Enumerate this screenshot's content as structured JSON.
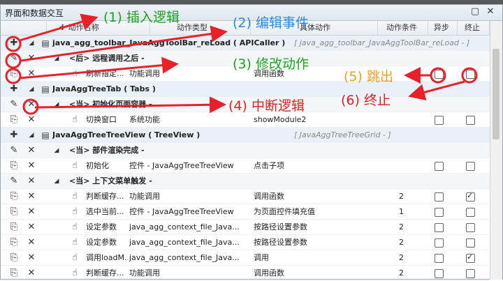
{
  "window": {
    "title": "界面和数据交互",
    "minimize_icon": "minimize-icon",
    "close_icon": "close-icon"
  },
  "columns": [
    "动作名称",
    "动作类型",
    "具体动作",
    "动作条件",
    "异步",
    "终止"
  ],
  "rows": [
    {
      "kind": "group",
      "icons": [
        "plus",
        "tri"
      ],
      "name": "java_agg_toolbar_JavaAggToolBar_reLoad ( APICaller )",
      "extra": "[ java_agg_toolbar_JavaAggToolBar_reLoad - ]"
    },
    {
      "kind": "sub",
      "icons": [
        "edit",
        "x"
      ],
      "name": "<后> 远程调用之后 -"
    },
    {
      "kind": "item",
      "name": "刷新指定...",
      "type": "功能调用",
      "action": "调用函数",
      "cond": "",
      "async": false,
      "stop": false
    },
    {
      "kind": "group",
      "icons": [
        "plus",
        "tri"
      ],
      "name": "JavaAggTreeTab ( Tabs )",
      "extra": ""
    },
    {
      "kind": "sub",
      "icons": [
        "edit",
        "x"
      ],
      "name": "<当> 初始化页面容器 -"
    },
    {
      "kind": "item",
      "name": "切换窗口",
      "type": "系统功能",
      "action": "showModule2",
      "cond": "",
      "async": false,
      "stop": false
    },
    {
      "kind": "group",
      "icons": [
        "plus",
        "tri"
      ],
      "name": "JavaAggTreeTreeView ( TreeView )",
      "extra": "[ JavaAggTreeTreeGrid - ]"
    },
    {
      "kind": "sub",
      "icons": [
        "edit",
        "x"
      ],
      "name": "<当> 部件渲染完成 -"
    },
    {
      "kind": "item",
      "name": "初始化",
      "type": "控件 - JavaAggTreeTreeView",
      "action": "点击子项",
      "cond": "",
      "async": false,
      "stop": false
    },
    {
      "kind": "sub",
      "icons": [
        "edit",
        "x"
      ],
      "name": "<当> 上下文菜单触发 -"
    },
    {
      "kind": "item",
      "name": "判断缓存...",
      "type": "功能调用",
      "action": "调用函数",
      "cond": "2",
      "async": false,
      "stop": true
    },
    {
      "kind": "item",
      "name": "选中当前...",
      "type": "控件 - JavaAggTreeTreeView",
      "action": "为页面控件填充值",
      "cond": "1",
      "async": false,
      "stop": false
    },
    {
      "kind": "item",
      "name": "设定参数",
      "type": "java_agg_context_file_Java...",
      "action": "按路径设置参数",
      "cond": "2",
      "async": false,
      "stop": false
    },
    {
      "kind": "item",
      "name": "设定参数",
      "type": "java_agg_context_file_Java...",
      "action": "按路径设置参数",
      "cond": "2",
      "async": false,
      "stop": false
    },
    {
      "kind": "item",
      "name": "调用loadM...",
      "type": "java_agg_context_file_Java...",
      "action": "调用",
      "cond": "2",
      "async": false,
      "stop": true
    },
    {
      "kind": "item",
      "name": "判断缓存...",
      "type": "功能调用",
      "action": "调用函数",
      "cond": "2",
      "async": false,
      "stop": false
    }
  ],
  "annotations": [
    {
      "text": "(1) 插入逻辑",
      "color": "#1ea21e"
    },
    {
      "text": "(2) 编辑事件",
      "color": "#2a8ae0"
    },
    {
      "text": "(3) 修改动作",
      "color": "#1ea21e"
    },
    {
      "text": "(4) 中断逻辑",
      "color": "#e02020"
    },
    {
      "text": "(5) 跳出",
      "color": "#f0a020"
    },
    {
      "text": "(6) 终止",
      "color": "#e02020"
    }
  ],
  "colors": {
    "arrow": "#e8202a",
    "title_bg": "#e6edf4",
    "group_bg": "#e9f0f8"
  }
}
